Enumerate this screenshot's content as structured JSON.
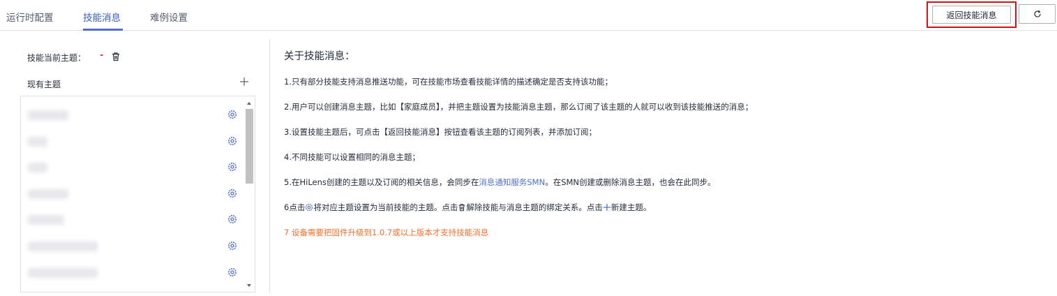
{
  "tabs": [
    {
      "label": "运行时配置"
    },
    {
      "label": "技能消息"
    },
    {
      "label": "难例设置"
    }
  ],
  "toolbar": {
    "return_label": "返回技能消息",
    "refresh_icon": "refresh-icon"
  },
  "left": {
    "current_label": "技能当前主题：",
    "current_value": "-",
    "existing_label": "现有主题"
  },
  "info": {
    "title": "关于技能消息：",
    "line1": "1.只有部分技能支持消息推送功能，可在技能市场查看技能详情的描述确定是否支持该功能；",
    "line2": "2.用户可以创建消息主题，比如【家庭成员】，并把主题设置为技能消息主题，那么订阅了该主题的人就可以收到该技能推送的消息；",
    "line3": "3.设置技能主题后，可点击【返回技能消息】按钮查看该主题的订阅列表，并添加订阅；",
    "line4": "4.不同技能可以设置相同的消息主题；",
    "line5_a": "5.在HiLens创建的主题以及订阅的相关信息，会同步在",
    "line5_link": "消息通知服务SMN",
    "line5_b": "。在SMN创建或删除消息主题，也会在此同步。",
    "line6_a": "6点击",
    "line6_b": "将对应主题设置为当前技能的主题。点击",
    "line6_c": "解除技能与消息主题的绑定关系。点击",
    "line6_d": "新建主题。",
    "line7": "7 设备需要把固件升级到1.0.7或以上版本才支持技能消息"
  },
  "colors": {
    "accent": "#526ecc",
    "danger": "#d0121b",
    "warning": "#f66f2a"
  }
}
